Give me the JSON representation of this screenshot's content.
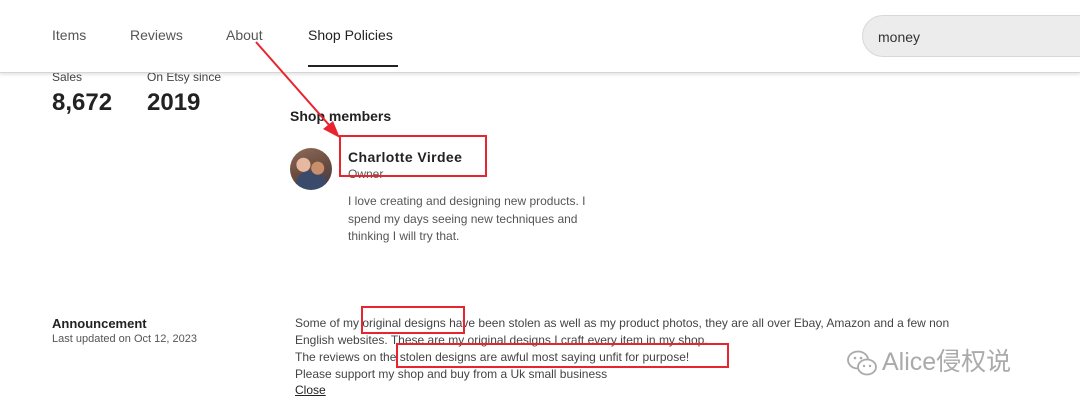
{
  "nav": {
    "tabs": [
      {
        "label": "Items"
      },
      {
        "label": "Reviews"
      },
      {
        "label": "About"
      },
      {
        "label": "Shop Policies"
      }
    ],
    "search_value": "money"
  },
  "stats": {
    "sales_label": "Sales",
    "sales_value": "8,672",
    "since_label": "On Etsy since",
    "since_value": "2019"
  },
  "shop_members": {
    "title": "Shop members",
    "member": {
      "name": "Charlotte Virdee",
      "role": "Owner",
      "bio": "I love creating and designing new products. I spend my days seeing new techniques and thinking I will try that."
    }
  },
  "announcement": {
    "title": "Announcement",
    "updated": "Last updated on Oct 12, 2023",
    "lines": [
      "Some of my original designs have been stolen as well as my product photos, they are all over Ebay, Amazon and a few non",
      "English websites. These are my original designs I craft every item in my shop.",
      "The reviews on the stolen designs are awful most saying unfit for purpose!",
      "Please support my shop and buy from a Uk small business"
    ],
    "close_label": "Close"
  },
  "annotation_color": "#e8242e",
  "watermark": {
    "text": "Alice侵权说",
    "icon": "wechat-icon"
  }
}
